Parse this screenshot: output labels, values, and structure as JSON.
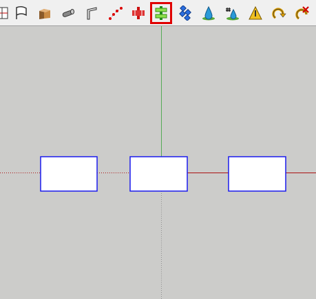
{
  "toolbar": {
    "selected": "tb-10",
    "tools": [
      {
        "id": "tb-0",
        "icon": "section-plane-icon"
      },
      {
        "id": "tb-1",
        "icon": "flag-icon"
      },
      {
        "id": "tb-2",
        "icon": "box-face-icon"
      },
      {
        "id": "tb-3",
        "icon": "pipe-icon"
      },
      {
        "id": "tb-4",
        "icon": "bent-profile-icon"
      },
      {
        "id": "tb-5",
        "icon": "curve-points-icon"
      },
      {
        "id": "tb-6",
        "icon": "red-push-pull-icon"
      },
      {
        "id": "tb-7",
        "icon": "green-align-icon"
      },
      {
        "id": "tb-8",
        "icon": "blue-pattern-icon"
      },
      {
        "id": "tb-9",
        "icon": "water-drop-icon"
      },
      {
        "id": "tb-10",
        "icon": "numbered-drop-icon"
      },
      {
        "id": "tb-11",
        "icon": "warning-triangle-icon"
      },
      {
        "id": "tb-12",
        "icon": "rotate-arrow-icon"
      },
      {
        "id": "tb-13",
        "icon": "cancel-rotate-icon"
      }
    ]
  },
  "colors": {
    "canvas_background": "#ccccca",
    "green_axis": "#55aa55",
    "red_axis": "#aa1111",
    "box_stroke": "#1a1aee",
    "box_fill": "#ffffff",
    "selection": "#e00000"
  }
}
